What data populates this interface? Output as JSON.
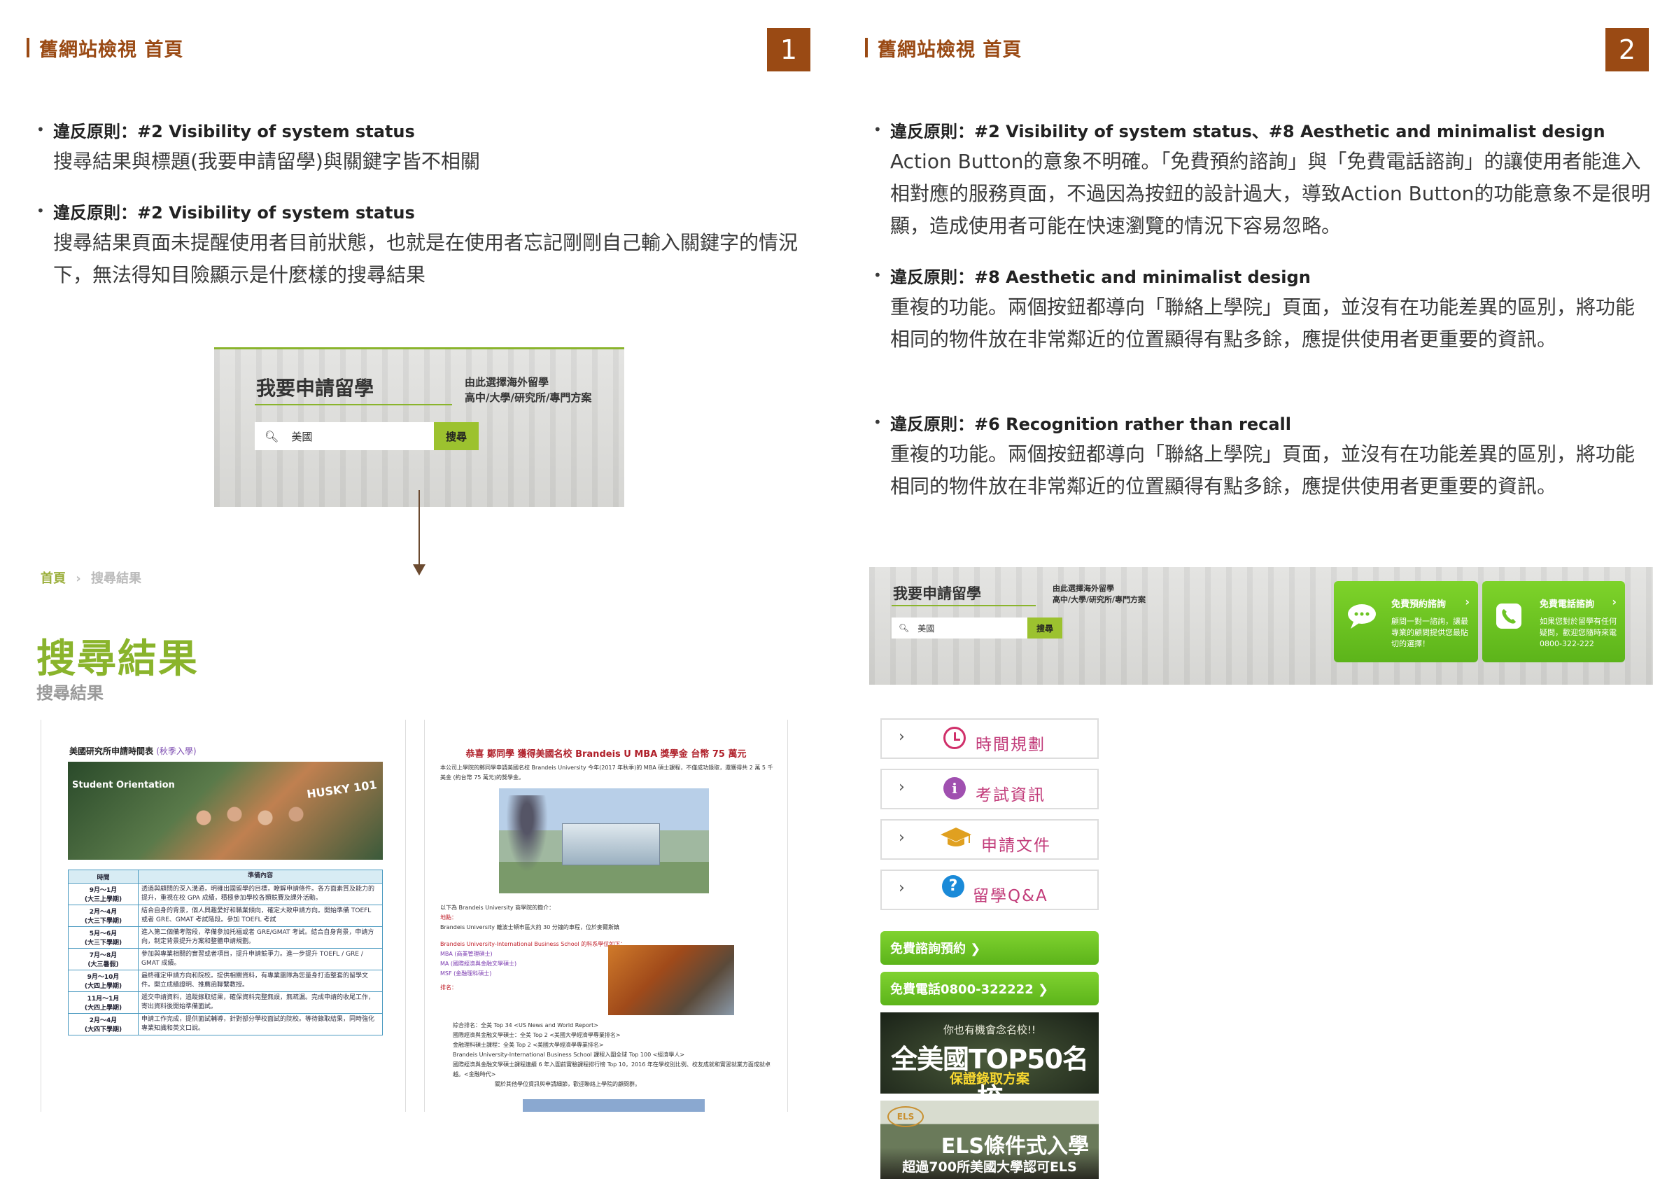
{
  "panel1": {
    "header": "舊網站檢視 首頁",
    "page_number": "1",
    "points": [
      {
        "label": "違反原則：",
        "principle": "#2 Visibility of system status",
        "body": "搜尋結果與標題(我要申請留學)與關鍵字皆不相關"
      },
      {
        "label": "違反原則：",
        "principle": "#2 Visibility of system status",
        "body_line1": "搜尋結果頁面未提醒使用者目前狀態，也就是在使用者忘記剛剛自己輸入關鍵字的情況",
        "body_line2": "下，無法得知目險顯示是什麼樣的搜尋結果"
      }
    ],
    "search_box": {
      "title": "我要申請留學",
      "subtitle_line1": "由此選擇海外留學",
      "subtitle_line2": "高中/大學/研究所/專門方案",
      "input_value": "美國",
      "button": "搜尋"
    },
    "breadcrumb": {
      "home": "首頁",
      "sep": "›",
      "current": "搜尋結果"
    },
    "result_title": "搜尋結果",
    "result_subtitle": "搜尋結果",
    "doc1": {
      "title": "美國研究所申請時間表",
      "title_note": "(秋季入學)",
      "photo_text1": "Student Orientation",
      "photo_text2": "HUSKY 101",
      "table_header": [
        "時間",
        "準備內容"
      ],
      "rows": [
        {
          "time": "9月～1月\n(大三上學期)",
          "content": "透過與顧問的深入溝通，明確出國留學的目標，瞭解申請條件。各方面素質及能力的提升，重視在校 GPA 成績，積極參加學校各類競賽及課外活動。"
        },
        {
          "time": "2月～4月\n(大三下學期)",
          "content": "結合自身的背景，個人興趣愛好和職業傾向，確定大致申請方向。開始準備 TOEFL 或者 GRE、GMAT 考試階段。參加 TOEFL 考試"
        },
        {
          "time": "5月～6月\n(大三下學期)",
          "content": "進入第二個備考階段，準備參加托福或者 GRE/GMAT 考試。結合自身背景，申請方向，制定背景提升方案和整體申請規劃。"
        },
        {
          "time": "7月～8月\n(大三暑假)",
          "content": "參加與專業相關的實習或者項目，提升申請競爭力。進一步提升 TOEFL / GRE / GMAT 成績。"
        },
        {
          "time": "9月～10月\n(大四上學期)",
          "content": "最終確定申請方向和院校。提供相關資料，有專業團隊為您量身打造整套的留學文件。開立成績證明、推薦函聯繫教授。"
        },
        {
          "time": "11月～1月\n(大四上學期)",
          "content": "遞交申請資料，追蹤錄取結果，確保資料完整無誤，無疏漏。完成申請的收尾工作，寄出資料後開始準備面試。"
        },
        {
          "time": "2月～4月\n(大四下學期)",
          "content": "申請工作完成，提供面試輔導，針對部分學校面試的院校。等待錄取結果，同時強化專業知識和英文口說。"
        }
      ]
    },
    "doc2": {
      "title": "恭喜 鄭同學 獲得美國名校 Brandeis U MBA 獎學金 台幣 75 萬元",
      "intro": "本公司上學院的鄭同學申請美國名校 Brandeis University 今年(2017 年秋季)的 MBA 碩士課程，不僅成功錄取，還獲得共 2 萬 5 千美金 (約台幣 75 萬元)的獎學金。",
      "lines": [
        "以下為 Brandeis University 商學院的簡介：",
        "地點：",
        "Brandeis University 離波士頓市區大約 30 分鐘的車程，位於麥爾斯鎮",
        "Brandeis University-International Business School 的科系學位如下：",
        "MBA (商業管理碩士)",
        "MA (國際經濟與金融文學碩士)",
        "MSF (金融理科碩士)",
        "排名：",
        "綜合排名：全美 Top 34 <US News and World Report>",
        "國際經濟與金融文學碩士：全美 Top 2 <美國大學經濟學專業排名>",
        "金融理科碩士課程：全美 Top 2 <美國大學經濟學專業排名>",
        "Brandeis University-International Business School 課程入圍全球 Top 100 <經濟學人>",
        "國際經濟與金融文學碩士課程連續 6 年入圍前實驗課程排行榜 Top 10，2016 年在學校別比例、校友成就和實習就業方面成就卓越。<金融時代>",
        "關於其他學位資訊與申請細節，歡迎聯絡上學院的顧問群。"
      ]
    }
  },
  "panel2": {
    "header": "舊網站檢視 首頁",
    "page_number": "2",
    "points": [
      {
        "label": "違反原則：",
        "principle": "#2 Visibility of system status、#8 Aesthetic and minimalist design",
        "body_line1": "Action Button的意象不明確。「免費預約諮詢」與「免費電話諮詢」的讓使用者能進入",
        "body_line2": "相對應的服務頁面，不過因為按鈕的設計過大，導致Action Button的功能意象不是很明",
        "body_line3": "顯，造成使用者可能在快速瀏覽的情況下容易忽略。"
      },
      {
        "label": "違反原則：",
        "principle": "#8 Aesthetic and minimalist design",
        "body_line1": "重複的功能。兩個按鈕都導向「聯絡上學院」頁面，並沒有在功能差異的區別，將功能",
        "body_line2": "相同的物件放在非常鄰近的位置顯得有點多餘，應提供使用者更重要的資訊。"
      },
      {
        "label": "違反原則：",
        "principle": "#6 Recognition rather than recall",
        "body_line1": "重複的功能。兩個按鈕都導向「聯絡上學院」頁面，並沒有在功能差異的區別，將功能",
        "body_line2": "相同的物件放在非常鄰近的位置顯得有點多餘，應提供使用者更重要的資訊。"
      }
    ],
    "search_box": {
      "title": "我要申請留學",
      "subtitle_line1": "由此選擇海外留學",
      "subtitle_line2": "高中/大學/研究所/專門方案",
      "input_value": "美國",
      "button": "搜尋"
    },
    "cta1": {
      "title": "免費預約諮詢",
      "chev": "›",
      "desc": "顧問一對一諮詢，讓最專業的顧問提供您最貼切的選擇！"
    },
    "cta2": {
      "title": "免費電話諮詢",
      "chev": "›",
      "desc": "如果您對於留學有任何疑問，歡迎您隨時來電 0800-322-222"
    },
    "menu": [
      {
        "label": "時間規劃",
        "icon": "clock-icon",
        "color": "#d0306a"
      },
      {
        "label": "考試資訊",
        "icon": "info-icon",
        "color": "#a050b0"
      },
      {
        "label": "申請文件",
        "icon": "graduation-cap-icon",
        "color": "#e0a020"
      },
      {
        "label": "留學Q&A",
        "icon": "question-icon",
        "color": "#1a8ad8"
      }
    ],
    "green_buttons": [
      "免費諮詢預約 ❯",
      "免費電話0800-322222 ❯"
    ],
    "ad1": {
      "line1": "你也有機會念名校!!",
      "line2": "全美國TOP50名校",
      "line3": "保證錄取方案"
    },
    "ad2": {
      "logo": "ELS",
      "line1": "ELS條件式入學",
      "line2": "超過700所美國大學認可ELS"
    }
  },
  "colors": {
    "accent_brown": "#9a4a14",
    "accent_green": "#8ab42c",
    "cta_green": "#6cc424"
  }
}
